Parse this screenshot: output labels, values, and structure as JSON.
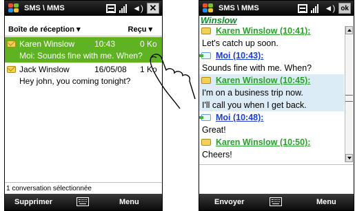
{
  "left": {
    "app_title": "SMS \\ MMS",
    "header_left": "Boîte de réception ▾",
    "header_right": "Reçu ▾",
    "messages": [
      {
        "name": "Karen Winslow",
        "time": "10:43",
        "size": "0 Ko",
        "preview": "Moi: Sounds fine with me. When?",
        "selected": true
      },
      {
        "name": "Jack Winslow",
        "time": "16/05/08",
        "size": "1 Ko",
        "preview": "Hey john, you coming tonight?",
        "selected": false
      }
    ],
    "status": "1 conversation sélectionnée",
    "softkey_left": "Supprimer",
    "softkey_right": "Menu",
    "close_label": "✕"
  },
  "right": {
    "app_title": "SMS \\ MMS",
    "ok_label": "ok",
    "conversation_title": "Winslow",
    "thread": [
      {
        "kind": "header",
        "sender": "karen",
        "text": "Karen Winslow (10:41):"
      },
      {
        "kind": "body",
        "text": "Let's catch up soon."
      },
      {
        "kind": "header",
        "sender": "moi",
        "text": "Moi (10:43):"
      },
      {
        "kind": "body",
        "text": "Sounds fine with me. When?"
      },
      {
        "kind": "header",
        "sender": "karen",
        "text": "Karen Winslow (10:45):",
        "highlight": true
      },
      {
        "kind": "body",
        "text": "I'm on a business trip now.",
        "highlight": true
      },
      {
        "kind": "body",
        "text": "I'll call you when I get back.",
        "highlight": true
      },
      {
        "kind": "header",
        "sender": "moi",
        "text": "Moi (10:48):"
      },
      {
        "kind": "body",
        "text": "Great!"
      },
      {
        "kind": "header",
        "sender": "karen",
        "text": "Karen Winslow (10:50):"
      },
      {
        "kind": "body",
        "text": "Cheers!"
      }
    ],
    "softkey_left": "Envoyer",
    "softkey_right": "Menu"
  },
  "icons": {
    "windows": "windows-logo-icon",
    "keyboard": "keyboard-icon",
    "signal": "signal-icon",
    "volume": "volume-icon",
    "envelope": "envelope-icon",
    "hand": "hand-tap-icon"
  },
  "colors": {
    "selected_row": "#5fb323",
    "karen_link": "#2aa02a",
    "moi_link": "#1a3fd0",
    "highlight": "#dcecf6"
  }
}
